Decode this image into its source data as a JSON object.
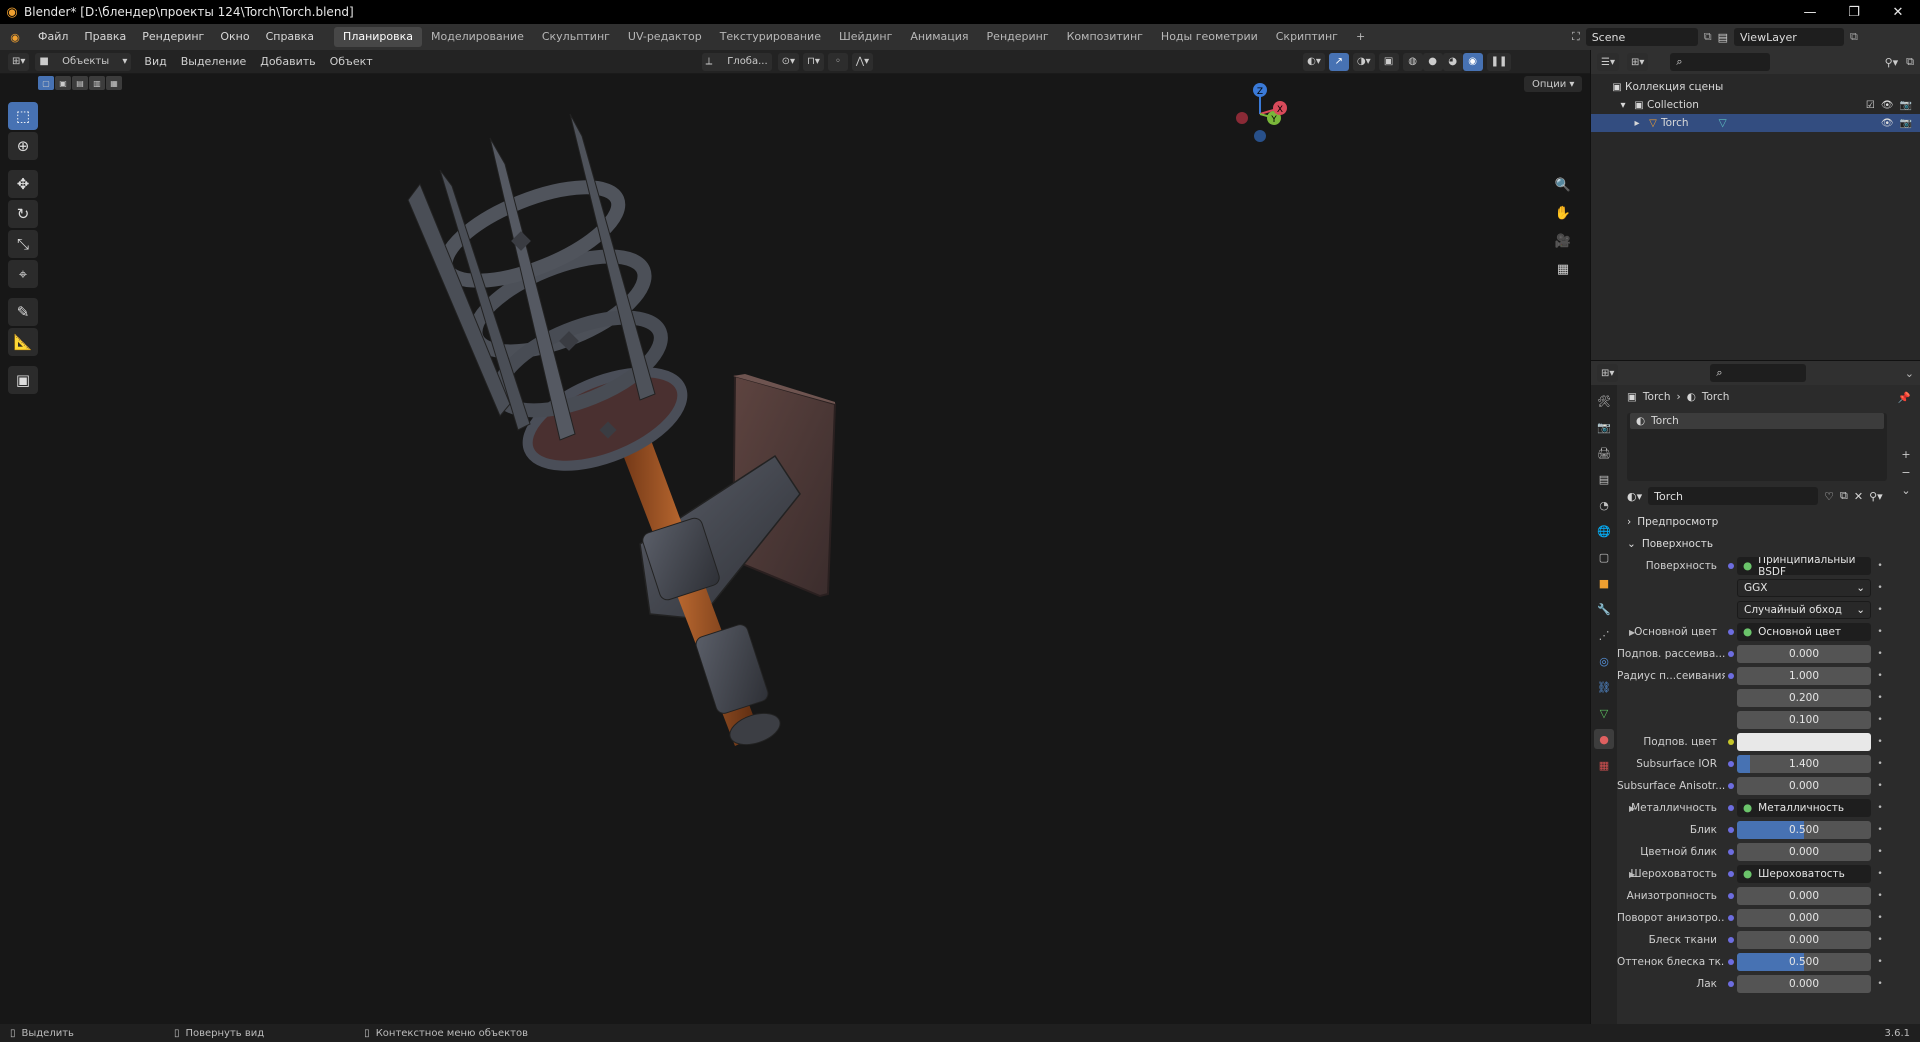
{
  "window": {
    "title": "Blender* [D:\\блендер\\проекты 124\\Torch\\Torch.blend]",
    "min": "—",
    "max": "❐",
    "close": "✕"
  },
  "menu": [
    "Файл",
    "Правка",
    "Рендеринг",
    "Окно",
    "Справка"
  ],
  "workspaces": [
    "Планировка",
    "Моделирование",
    "Скульптинг",
    "UV-редактор",
    "Текстурирование",
    "Шейдинг",
    "Анимация",
    "Рендеринг",
    "Композитинг",
    "Ноды геометрии",
    "Скриптинг"
  ],
  "workspace_add": "+",
  "scene": {
    "name": "Scene",
    "view_layer": "ViewLayer"
  },
  "viewport_header": {
    "mode": "Объекты",
    "menu": [
      "Вид",
      "Выделение",
      "Добавить",
      "Объект"
    ],
    "transform": "Глоба...",
    "options": "Опции"
  },
  "gizmo": {
    "z": "Z",
    "y": "Y",
    "x": "X"
  },
  "outliner": {
    "scene_collection": "Коллекция сцены",
    "collection": "Collection",
    "object": "Torch"
  },
  "properties": {
    "breadcrumb": [
      "Torch",
      "Torch"
    ],
    "slot": "Torch",
    "material_name": "Torch",
    "preview_label": "Предпросмотр",
    "surface_panel": "Поверхность",
    "rows": [
      {
        "label": "Поверхность",
        "kind": "link",
        "value": "Принципиальный BSDF"
      },
      {
        "label": "",
        "kind": "menu",
        "value": "GGX"
      },
      {
        "label": "",
        "kind": "menu",
        "value": "Случайный обход"
      },
      {
        "label": "Основной цвет",
        "kind": "link",
        "value": "Основной цвет",
        "expand": true
      },
      {
        "label": "Подпов. рассеива...",
        "kind": "num",
        "value": "0.000",
        "fill": 0
      },
      {
        "label": "Радиус п...сеивания",
        "kind": "num",
        "value": "1.000",
        "fill": 0
      },
      {
        "label": "",
        "kind": "num",
        "value": "0.200",
        "fill": 0,
        "nodot": true
      },
      {
        "label": "",
        "kind": "num",
        "value": "0.100",
        "fill": 0,
        "nodot": true
      },
      {
        "label": "Подпов. цвет",
        "kind": "color",
        "value": "",
        "dot": "y"
      },
      {
        "label": "Subsurface IOR",
        "kind": "num",
        "value": "1.400",
        "fill": 0.1
      },
      {
        "label": "Subsurface Anisotr...",
        "kind": "num",
        "value": "0.000",
        "fill": 0
      },
      {
        "label": "Металличность",
        "kind": "link",
        "value": "Металличность",
        "expand": true
      },
      {
        "label": "Блик",
        "kind": "num",
        "value": "0.500",
        "fill": 0.5
      },
      {
        "label": "Цветной блик",
        "kind": "num",
        "value": "0.000",
        "fill": 0
      },
      {
        "label": "Шероховатость",
        "kind": "link",
        "value": "Шероховатость",
        "expand": true
      },
      {
        "label": "Анизотропность",
        "kind": "num",
        "value": "0.000",
        "fill": 0
      },
      {
        "label": "Поворот анизотро...",
        "kind": "num",
        "value": "0.000",
        "fill": 0
      },
      {
        "label": "Блеск ткани",
        "kind": "num",
        "value": "0.000",
        "fill": 0
      },
      {
        "label": "Оттенок блеска тк...",
        "kind": "num",
        "value": "0.500",
        "fill": 0.5
      },
      {
        "label": "Лак",
        "kind": "num",
        "value": "0.000",
        "fill": 0
      }
    ]
  },
  "status": {
    "select": "Выделить",
    "rotate": "Повернуть вид",
    "context": "Контекстное меню объектов",
    "version": "3.6.1"
  },
  "colors": {
    "accent": "#4772b3",
    "selected_row": "#334d80",
    "wood": "#a65a2a",
    "metal": "#4a4e58"
  }
}
